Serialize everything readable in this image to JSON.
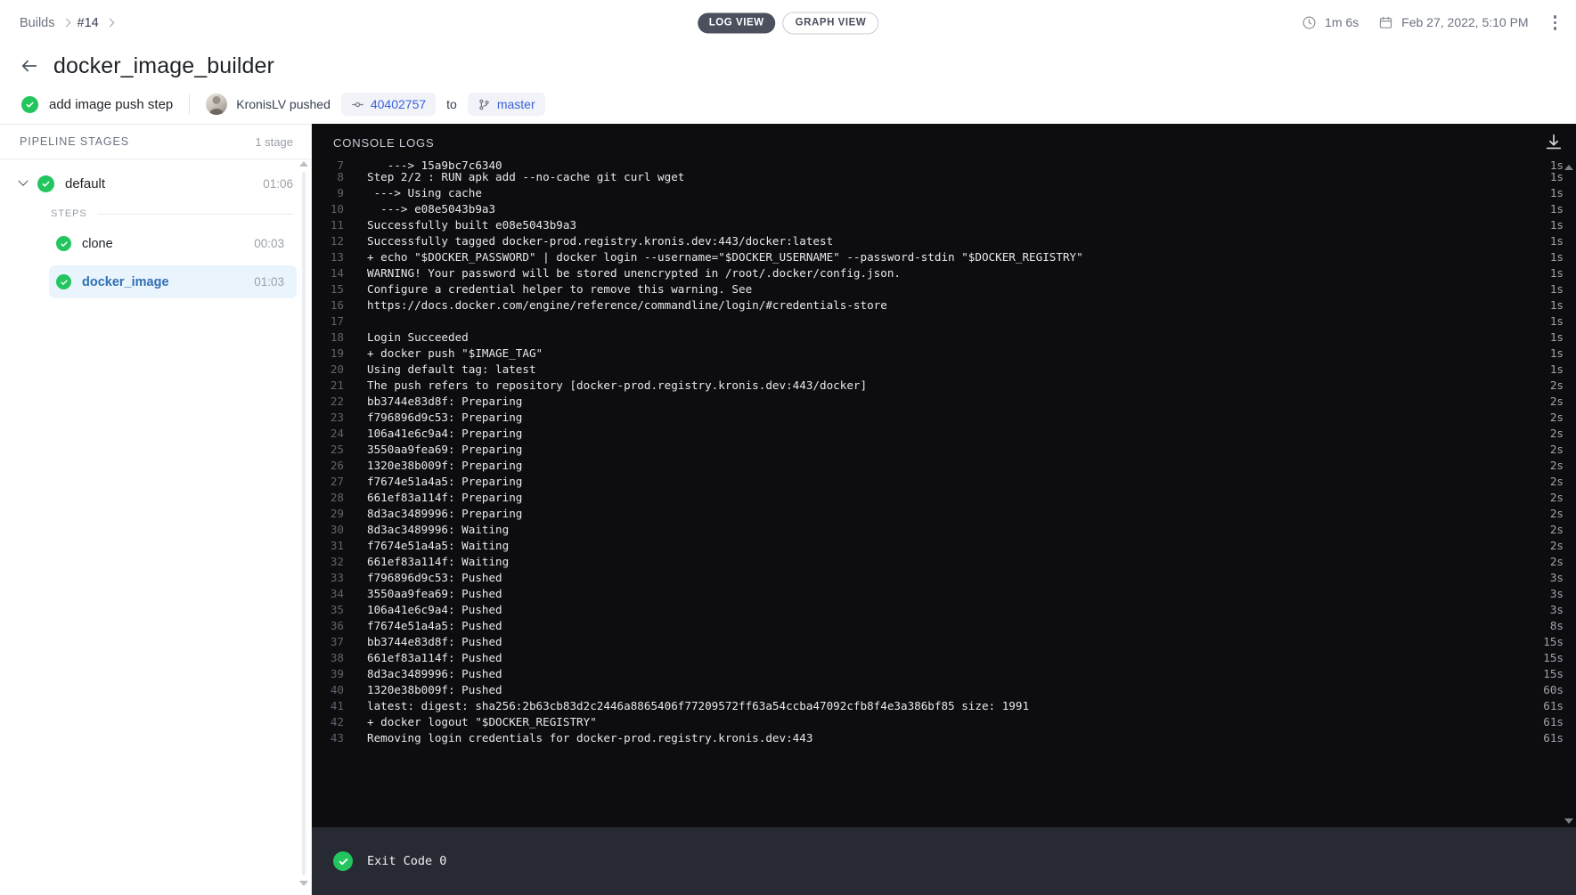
{
  "topbar": {
    "breadcrumb": [
      {
        "label": "Builds",
        "link": true
      },
      {
        "label": "#14",
        "link": false
      }
    ],
    "view_tabs": [
      {
        "label": "LOG VIEW",
        "active": true
      },
      {
        "label": "GRAPH VIEW",
        "active": false
      }
    ],
    "duration": "1m 6s",
    "datetime": "Feb 27, 2022, 5:10 PM",
    "clock_icon": "clock-icon",
    "calendar_icon": "calendar-icon",
    "menu_icon": "kebab-menu-icon"
  },
  "header": {
    "back_icon": "back-arrow-icon",
    "title": "docker_image_builder",
    "status_icon": "check-circle-icon",
    "commit_message": "add image push step",
    "author": "KronisLV pushed",
    "commit_hash": "40402757",
    "commit_icon": "commit-icon",
    "to_label": "to",
    "branch": "master",
    "branch_icon": "branch-icon"
  },
  "sidebar": {
    "title": "PIPELINE STAGES",
    "count": "1 stage",
    "stage": {
      "name": "default",
      "duration": "01:06",
      "expanded": true,
      "chevron_icon": "chevron-down-icon",
      "status_icon": "check-circle-icon"
    },
    "steps_label": "STEPS",
    "steps": [
      {
        "name": "clone",
        "duration": "00:03",
        "selected": false,
        "status_icon": "check-circle-icon"
      },
      {
        "name": "docker_image",
        "duration": "01:03",
        "selected": true,
        "status_icon": "check-circle-icon"
      }
    ]
  },
  "console": {
    "title": "CONSOLE LOGS",
    "download_icon": "download-icon",
    "scroll_up_icon": "scroll-up-arrow-icon",
    "scroll_down_icon": "scroll-down-arrow-icon",
    "exit_status_icon": "check-circle-icon",
    "exit_text": "Exit Code 0",
    "lines": [
      {
        "n": "7",
        "text": "   ---> 15a9bc7c6340",
        "dur": "1s",
        "clipped": true
      },
      {
        "n": "8",
        "text": "Step 2/2 : RUN apk add --no-cache git curl wget",
        "dur": "1s"
      },
      {
        "n": "9",
        "text": " ---> Using cache",
        "dur": "1s"
      },
      {
        "n": "10",
        "text": "  ---> e08e5043b9a3",
        "dur": "1s"
      },
      {
        "n": "11",
        "text": "Successfully built e08e5043b9a3",
        "dur": "1s"
      },
      {
        "n": "12",
        "text": "Successfully tagged docker-prod.registry.kronis.dev:443/docker:latest",
        "dur": "1s"
      },
      {
        "n": "13",
        "text": "+ echo \"$DOCKER_PASSWORD\" | docker login --username=\"$DOCKER_USERNAME\" --password-stdin \"$DOCKER_REGISTRY\"",
        "dur": "1s"
      },
      {
        "n": "14",
        "text": "WARNING! Your password will be stored unencrypted in /root/.docker/config.json.",
        "dur": "1s"
      },
      {
        "n": "15",
        "text": "Configure a credential helper to remove this warning. See",
        "dur": "1s"
      },
      {
        "n": "16",
        "text": "https://docs.docker.com/engine/reference/commandline/login/#credentials-store",
        "dur": "1s"
      },
      {
        "n": "17",
        "text": "",
        "dur": "1s"
      },
      {
        "n": "18",
        "text": "Login Succeeded",
        "dur": "1s"
      },
      {
        "n": "19",
        "text": "+ docker push \"$IMAGE_TAG\"",
        "dur": "1s"
      },
      {
        "n": "20",
        "text": "Using default tag: latest",
        "dur": "1s"
      },
      {
        "n": "21",
        "text": "The push refers to repository [docker-prod.registry.kronis.dev:443/docker]",
        "dur": "2s"
      },
      {
        "n": "22",
        "text": "bb3744e83d8f: Preparing",
        "dur": "2s"
      },
      {
        "n": "23",
        "text": "f796896d9c53: Preparing",
        "dur": "2s"
      },
      {
        "n": "24",
        "text": "106a41e6c9a4: Preparing",
        "dur": "2s"
      },
      {
        "n": "25",
        "text": "3550aa9fea69: Preparing",
        "dur": "2s"
      },
      {
        "n": "26",
        "text": "1320e38b009f: Preparing",
        "dur": "2s"
      },
      {
        "n": "27",
        "text": "f7674e51a4a5: Preparing",
        "dur": "2s"
      },
      {
        "n": "28",
        "text": "661ef83a114f: Preparing",
        "dur": "2s"
      },
      {
        "n": "29",
        "text": "8d3ac3489996: Preparing",
        "dur": "2s"
      },
      {
        "n": "30",
        "text": "8d3ac3489996: Waiting",
        "dur": "2s"
      },
      {
        "n": "31",
        "text": "f7674e51a4a5: Waiting",
        "dur": "2s"
      },
      {
        "n": "32",
        "text": "661ef83a114f: Waiting",
        "dur": "2s"
      },
      {
        "n": "33",
        "text": "f796896d9c53: Pushed",
        "dur": "3s"
      },
      {
        "n": "34",
        "text": "3550aa9fea69: Pushed",
        "dur": "3s"
      },
      {
        "n": "35",
        "text": "106a41e6c9a4: Pushed",
        "dur": "3s"
      },
      {
        "n": "36",
        "text": "f7674e51a4a5: Pushed",
        "dur": "8s"
      },
      {
        "n": "37",
        "text": "bb3744e83d8f: Pushed",
        "dur": "15s"
      },
      {
        "n": "38",
        "text": "661ef83a114f: Pushed",
        "dur": "15s"
      },
      {
        "n": "39",
        "text": "8d3ac3489996: Pushed",
        "dur": "15s"
      },
      {
        "n": "40",
        "text": "1320e38b009f: Pushed",
        "dur": "60s"
      },
      {
        "n": "41",
        "text": "latest: digest: sha256:2b63cb83d2c2446a8865406f77209572ff63a54ccba47092cfb8f4e3a386bf85 size: 1991",
        "dur": "61s"
      },
      {
        "n": "42",
        "text": "+ docker logout \"$DOCKER_REGISTRY\"",
        "dur": "61s"
      },
      {
        "n": "43",
        "text": "Removing login credentials for docker-prod.registry.kronis.dev:443",
        "dur": "61s"
      }
    ]
  },
  "colors": {
    "success": "#22c55e",
    "link": "#3b62d9",
    "console_bg": "#0d0d10",
    "footer_bg": "#272a33",
    "selected_step": "#eaf4fd"
  }
}
